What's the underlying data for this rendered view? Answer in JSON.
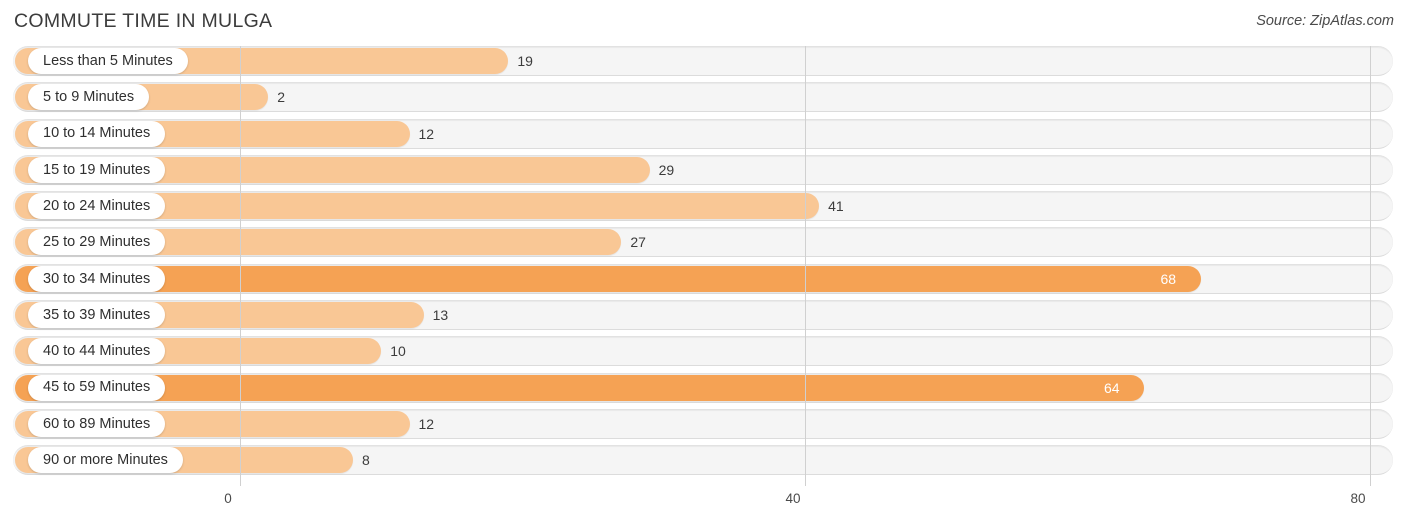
{
  "header": {
    "title": "COMMUTE TIME IN MULGA",
    "source": "Source: ZipAtlas.com"
  },
  "colors": {
    "bar_light": "#f9c795",
    "bar_dark": "#f5a254",
    "track": "#f5f5f5",
    "gridline": "#d0d0d0",
    "text": "#3c3c3c",
    "value_inside": "#ffffff"
  },
  "axis": {
    "ticks": [
      {
        "label": "0",
        "value": 0
      },
      {
        "label": "40",
        "value": 40
      },
      {
        "label": "80",
        "value": 80
      }
    ],
    "min": 0,
    "max": 80
  },
  "chart_data": {
    "type": "bar",
    "orientation": "horizontal",
    "title": "COMMUTE TIME IN MULGA",
    "subtitle": "",
    "xlabel": "",
    "ylabel": "",
    "xlim": [
      0,
      80
    ],
    "grid": true,
    "legend": null,
    "source": "Source: ZipAtlas.com",
    "categories": [
      "Less than 5 Minutes",
      "5 to 9 Minutes",
      "10 to 14 Minutes",
      "15 to 19 Minutes",
      "20 to 24 Minutes",
      "25 to 29 Minutes",
      "30 to 34 Minutes",
      "35 to 39 Minutes",
      "40 to 44 Minutes",
      "45 to 59 Minutes",
      "60 to 89 Minutes",
      "90 or more Minutes"
    ],
    "values": [
      19,
      2,
      12,
      29,
      41,
      27,
      68,
      13,
      10,
      64,
      12,
      8
    ],
    "bars": [
      {
        "label": "Less than 5 Minutes",
        "value": 19,
        "value_text": "19",
        "shade": "light",
        "value_inside": false
      },
      {
        "label": "5 to 9 Minutes",
        "value": 2,
        "value_text": "2",
        "shade": "light",
        "value_inside": false
      },
      {
        "label": "10 to 14 Minutes",
        "value": 12,
        "value_text": "12",
        "shade": "light",
        "value_inside": false
      },
      {
        "label": "15 to 19 Minutes",
        "value": 29,
        "value_text": "29",
        "shade": "light",
        "value_inside": false
      },
      {
        "label": "20 to 24 Minutes",
        "value": 41,
        "value_text": "41",
        "shade": "light",
        "value_inside": false
      },
      {
        "label": "25 to 29 Minutes",
        "value": 27,
        "value_text": "27",
        "shade": "light",
        "value_inside": false
      },
      {
        "label": "30 to 34 Minutes",
        "value": 68,
        "value_text": "68",
        "shade": "dark",
        "value_inside": true
      },
      {
        "label": "35 to 39 Minutes",
        "value": 13,
        "value_text": "13",
        "shade": "light",
        "value_inside": false
      },
      {
        "label": "40 to 44 Minutes",
        "value": 10,
        "value_text": "10",
        "shade": "light",
        "value_inside": false
      },
      {
        "label": "45 to 59 Minutes",
        "value": 64,
        "value_text": "64",
        "shade": "dark",
        "value_inside": true
      },
      {
        "label": "60 to 89 Minutes",
        "value": 12,
        "value_text": "12",
        "shade": "light",
        "value_inside": false
      },
      {
        "label": "90 or more Minutes",
        "value": 8,
        "value_text": "8",
        "shade": "light",
        "value_inside": false
      }
    ]
  }
}
